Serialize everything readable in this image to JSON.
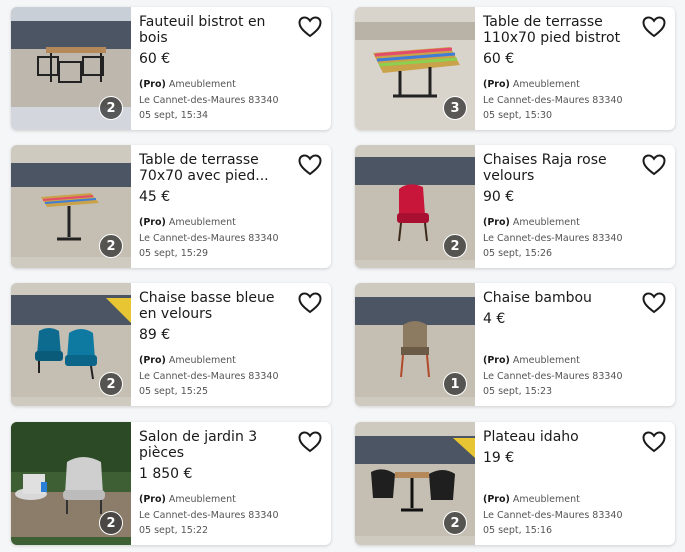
{
  "listings": [
    {
      "title": "Fauteuil bistrot en bois",
      "price": "60 €",
      "seller_type": "(Pro)",
      "category": "Ameublement",
      "location": "Le Cannet-des-Maures 83340",
      "date": "05 sept, 15:34",
      "photo_count": "2"
    },
    {
      "title": "Table de terrasse 110x70 pied bistrot",
      "price": "60 €",
      "seller_type": "(Pro)",
      "category": "Ameublement",
      "location": "Le Cannet-des-Maures 83340",
      "date": "05 sept, 15:30",
      "photo_count": "3"
    },
    {
      "title": "Table de terrasse 70x70 avec pied...",
      "price": "45 €",
      "seller_type": "(Pro)",
      "category": "Ameublement",
      "location": "Le Cannet-des-Maures 83340",
      "date": "05 sept, 15:29",
      "photo_count": "2"
    },
    {
      "title": "Chaises Raja rose velours",
      "price": "90 €",
      "seller_type": "(Pro)",
      "category": "Ameublement",
      "location": "Le Cannet-des-Maures 83340",
      "date": "05 sept, 15:26",
      "photo_count": "2"
    },
    {
      "title": "Chaise basse bleue en velours",
      "price": "89 €",
      "seller_type": "(Pro)",
      "category": "Ameublement",
      "location": "Le Cannet-des-Maures 83340",
      "date": "05 sept, 15:25",
      "photo_count": "2"
    },
    {
      "title": "Chaise bambou",
      "price": "4 €",
      "seller_type": "(Pro)",
      "category": "Ameublement",
      "location": "Le Cannet-des-Maures 83340",
      "date": "05 sept, 15:23",
      "photo_count": "1"
    },
    {
      "title": "Salon de jardin 3 pièces",
      "price": "1 850 €",
      "seller_type": "(Pro)",
      "category": "Ameublement",
      "location": "Le Cannet-des-Maures 83340",
      "date": "05 sept, 15:22",
      "photo_count": "2"
    },
    {
      "title": "Plateau idaho",
      "price": "19 €",
      "seller_type": "(Pro)",
      "category": "Ameublement",
      "location": "Le Cannet-des-Maures 83340",
      "date": "05 sept, 15:16",
      "photo_count": "2"
    }
  ],
  "icons": {
    "favorite": "heart-outline-icon"
  },
  "colors": {
    "text": "#1a1a1a",
    "meta": "#555555",
    "badge": "#3c3c3c",
    "card": "#ffffff",
    "background": "#f5f6f8"
  }
}
